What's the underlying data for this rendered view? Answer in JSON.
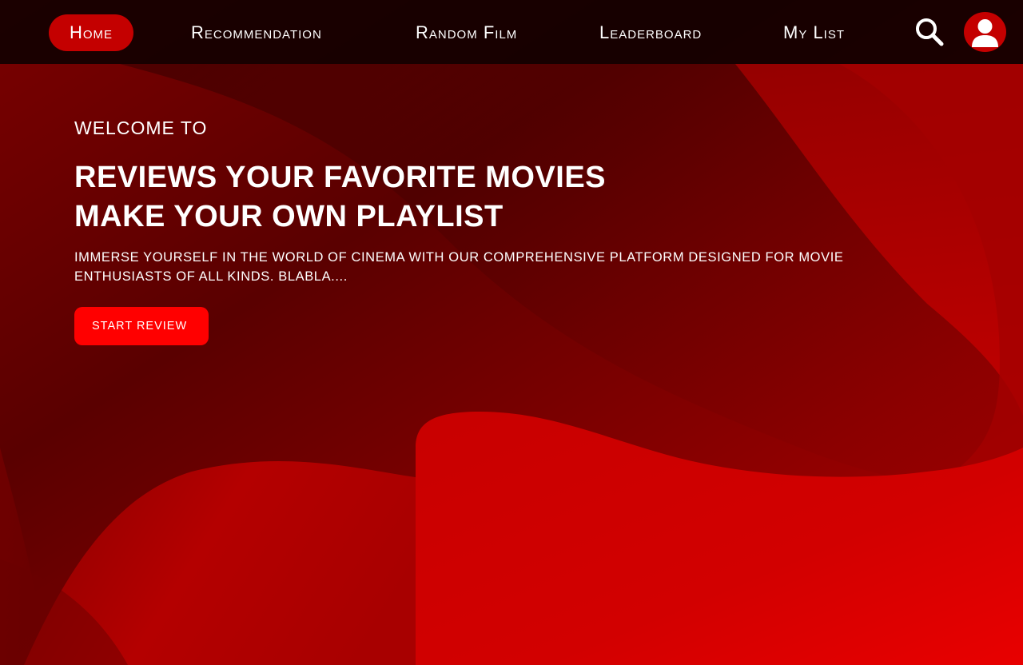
{
  "nav": {
    "items": [
      {
        "label": "Home",
        "active": true
      },
      {
        "label": "Recommendation",
        "active": false
      },
      {
        "label": "Random Film",
        "active": false
      },
      {
        "label": "Leaderboard",
        "active": false
      },
      {
        "label": "My List",
        "active": false
      }
    ],
    "search_icon": "search-icon",
    "avatar_icon": "user-icon"
  },
  "hero": {
    "welcome": "WELCOME TO",
    "headline_line1": "REVIEWS YOUR FAVORITE MOVIES",
    "headline_line2": "MAKE YOUR OWN PLAYLIST",
    "description": "IMMERSE YOURSELF IN THE WORLD OF CINEMA WITH OUR COMPREHENSIVE PLATFORM DESIGNED FOR MOVIE ENTHUSIASTS OF ALL KINDS. BLABLA....",
    "cta_label": "START REVIEW"
  },
  "colors": {
    "background_dark": "#3a0000",
    "background_mid": "#8a0000",
    "background_bright": "#e00000",
    "nav_bar": "#0e0000",
    "nav_active": "#c40000",
    "cta": "#ff0000",
    "text": "#ffffff"
  }
}
